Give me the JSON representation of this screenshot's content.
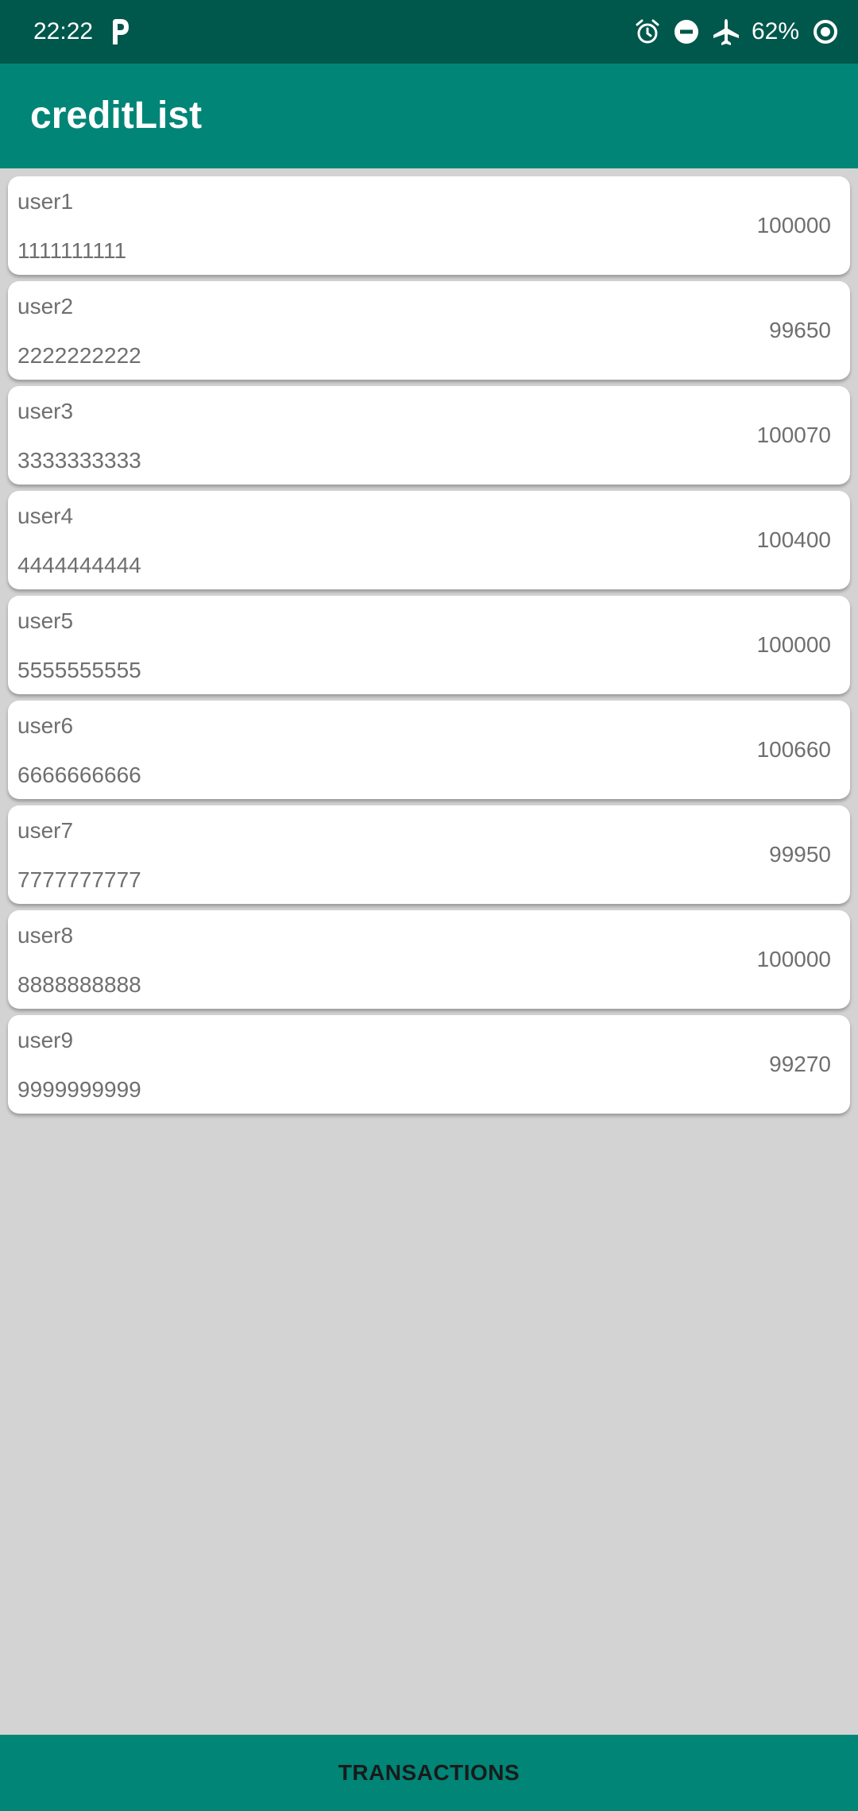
{
  "status_bar": {
    "time": "22:22",
    "battery": "62%",
    "icons": [
      "parking-icon",
      "alarm-icon",
      "do-not-disturb-icon",
      "airplane-mode-icon",
      "data-saver-icon"
    ]
  },
  "app_bar": {
    "title": "creditList"
  },
  "users": [
    {
      "name": "user1",
      "phone": "1111111111",
      "credit": "100000"
    },
    {
      "name": "user2",
      "phone": "2222222222",
      "credit": "99650"
    },
    {
      "name": "user3",
      "phone": "3333333333",
      "credit": "100070"
    },
    {
      "name": "user4",
      "phone": "4444444444",
      "credit": "100400"
    },
    {
      "name": "user5",
      "phone": "5555555555",
      "credit": "100000"
    },
    {
      "name": "user6",
      "phone": "6666666666",
      "credit": "100660"
    },
    {
      "name": "user7",
      "phone": "7777777777",
      "credit": "99950"
    },
    {
      "name": "user8",
      "phone": "8888888888",
      "credit": "100000"
    },
    {
      "name": "user9",
      "phone": "9999999999",
      "credit": "99270"
    }
  ],
  "bottom_bar": {
    "button_label": "TRANSACTIONS"
  },
  "colors": {
    "status_bar": "#00574b",
    "app_bar": "#008577",
    "background": "#d3d3d3",
    "card": "#ffffff",
    "text_secondary": "#6f6f6f"
  }
}
